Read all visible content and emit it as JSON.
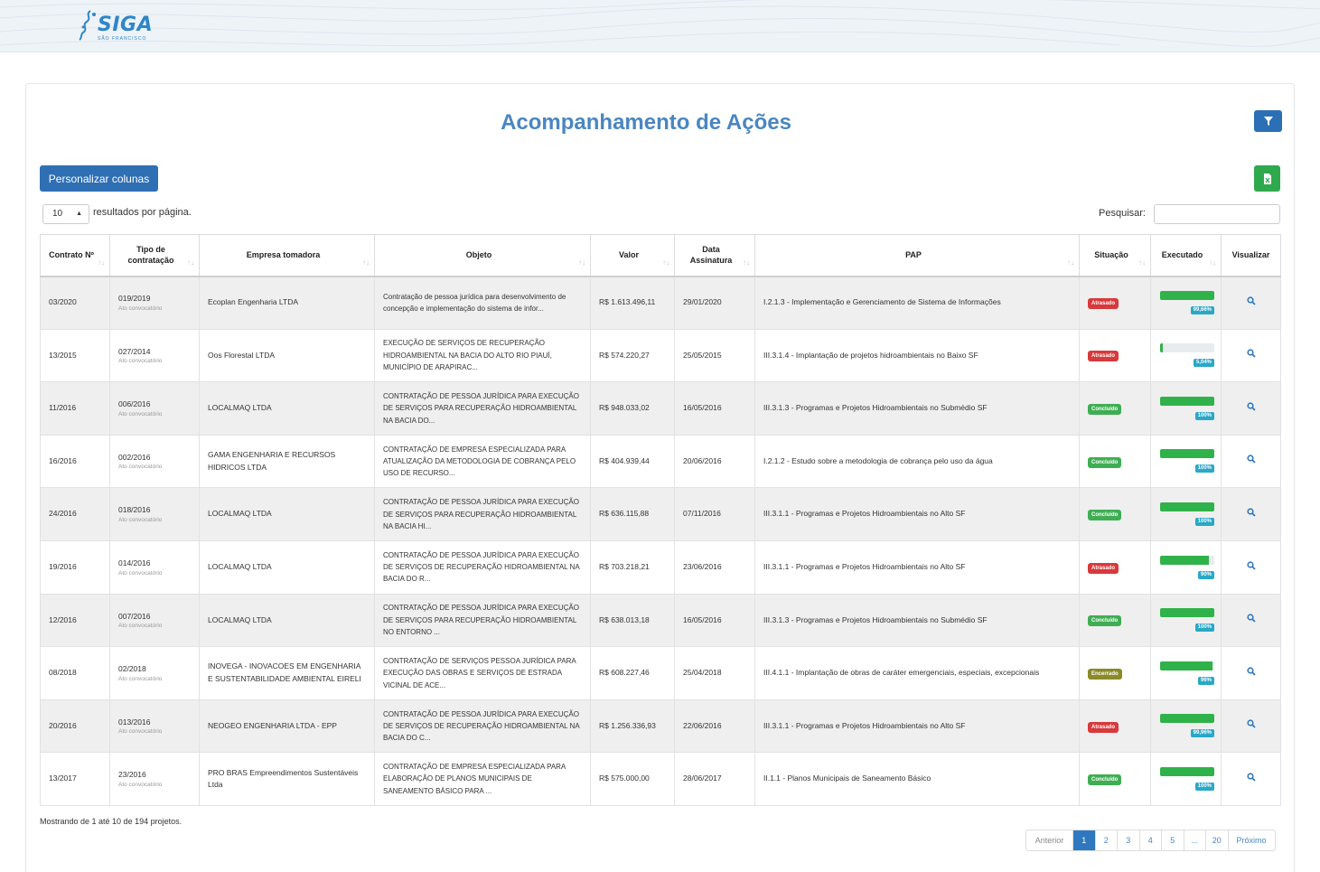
{
  "header": {
    "logo_text": "SIGA",
    "logo_sub": "SÃO FRANCISCO"
  },
  "page": {
    "title": "Acompanhamento de Ações"
  },
  "toolbar": {
    "customize_label": "Personalizar colunas",
    "page_length_value": "10",
    "page_length_suffix": "resultados por página.",
    "search_label": "Pesquisar:",
    "search_value": ""
  },
  "table": {
    "headers": [
      "Contrato Nº",
      "Tipo de contratação",
      "Empresa tomadora",
      "Objeto",
      "Valor",
      "Data Assinatura",
      "PAP",
      "Situação",
      "Executado",
      "Visualizar"
    ],
    "rows": [
      {
        "contrato": "03/2020",
        "tipo": "019/2019",
        "tipo_sub": "Ato convocatório",
        "empresa": "Ecoplan Engenharia LTDA",
        "objeto": "Contratação de pessoa jurídica para desenvolvimento de concepção e implementação do sistema de infor...",
        "valor": "R$ 1.613.496,11",
        "data": "29/01/2020",
        "pap": "I.2.1.3 - Implementação e Gerenciamento de Sistema de Informações",
        "situacao": "Atrasado",
        "situacao_color": "#d9393b",
        "executado": "99,66%",
        "executado_frac": 0.9966
      },
      {
        "contrato": "13/2015",
        "tipo": "027/2014",
        "tipo_sub": "Ato convocatório",
        "empresa": "Oos Florestal LTDA",
        "objeto": "EXECUÇÃO DE SERVIÇOS DE RECUPERAÇÃO HIDROAMBIENTAL NA BACIA DO ALTO RIO PIAUÍ, MUNICÍPIO DE ARAPIRAC...",
        "valor": "R$ 574.220,27",
        "data": "25/05/2015",
        "pap": "III.3.1.4 - Implantação de projetos hidroambientais no Baixo SF",
        "situacao": "Atrasado",
        "situacao_color": "#d9393b",
        "executado": "5,04%",
        "executado_frac": 0.0504
      },
      {
        "contrato": "11/2016",
        "tipo": "006/2016",
        "tipo_sub": "Ato convocatório",
        "empresa": "LOCALMAQ LTDA",
        "objeto": "CONTRATAÇÃO DE PESSOA JURÍDICA PARA EXECUÇÃO DE SERVIÇOS PARA RECUPERAÇÃO HIDROAMBIENTAL NA BACIA DO...",
        "valor": "R$ 948.033,02",
        "data": "16/05/2016",
        "pap": "III.3.1.3 - Programas e Projetos Hidroambientais no Submédio SF",
        "situacao": "Concluído",
        "situacao_color": "#3fae53",
        "executado": "100%",
        "executado_frac": 1.0
      },
      {
        "contrato": "16/2016",
        "tipo": "002/2016",
        "tipo_sub": "Ato convocatório",
        "empresa": "GAMA ENGENHARIA E RECURSOS HIDRICOS LTDA",
        "objeto": "CONTRATAÇÃO DE EMPRESA ESPECIALIZADA PARA ATUALIZAÇÃO DA METODOLOGIA DE COBRANÇA PELO USO DE RECURSO...",
        "valor": "R$ 404.939,44",
        "data": "20/06/2016",
        "pap": "I.2.1.2 - Estudo sobre a metodologia de cobrança pelo uso da água",
        "situacao": "Concluído",
        "situacao_color": "#3fae53",
        "executado": "100%",
        "executado_frac": 1.0
      },
      {
        "contrato": "24/2016",
        "tipo": "018/2016",
        "tipo_sub": "Ato convocatório",
        "empresa": "LOCALMAQ LTDA",
        "objeto": "CONTRATAÇÃO DE PESSOA JURÍDICA PARA EXECUÇÃO DE SERVIÇOS PARA RECUPERAÇÃO HIDROAMBIENTAL NA BACIA HI...",
        "valor": "R$ 636.115,88",
        "data": "07/11/2016",
        "pap": "III.3.1.1 - Programas e Projetos Hidroambientais no Alto SF",
        "situacao": "Concluído",
        "situacao_color": "#3fae53",
        "executado": "100%",
        "executado_frac": 1.0
      },
      {
        "contrato": "19/2016",
        "tipo": "014/2016",
        "tipo_sub": "Ato convocatório",
        "empresa": "LOCALMAQ LTDA",
        "objeto": "CONTRATAÇÃO DE PESSOA JURÍDICA PARA EXECUÇÃO DE SERVIÇOS DE RECUPERAÇÃO HIDROAMBIENTAL NA BACIA DO R...",
        "valor": "R$ 703.218,21",
        "data": "23/06/2016",
        "pap": "III.3.1.1 - Programas e Projetos Hidroambientais no Alto SF",
        "situacao": "Atrasado",
        "situacao_color": "#d9393b",
        "executado": "90%",
        "executado_frac": 0.9
      },
      {
        "contrato": "12/2016",
        "tipo": "007/2016",
        "tipo_sub": "Ato convocatório",
        "empresa": "LOCALMAQ LTDA",
        "objeto": "CONTRATAÇÃO DE PESSOA JURÍDICA PARA EXECUÇÃO DE SERVIÇOS PARA RECUPERAÇÃO HIDROAMBIENTAL NO ENTORNO ...",
        "valor": "R$ 638.013,18",
        "data": "16/05/2016",
        "pap": "III.3.1.3 - Programas e Projetos Hidroambientais no Submédio SF",
        "situacao": "Concluído",
        "situacao_color": "#3fae53",
        "executado": "100%",
        "executado_frac": 1.0
      },
      {
        "contrato": "08/2018",
        "tipo": "02/2018",
        "tipo_sub": "Ato convocatório",
        "empresa": "INOVEGA - INOVACOES EM ENGENHARIA E SUSTENTABILIDADE AMBIENTAL EIRELI",
        "objeto": "CONTRATAÇÃO DE SERVIÇOS PESSOA JURÍDICA PARA EXECUÇÃO DAS OBRAS E SERVIÇOS DE ESTRADA VICINAL DE ACE...",
        "valor": "R$ 608.227,46",
        "data": "25/04/2018",
        "pap": "III.4.1.1 - Implantação de obras de caráter emergenciais, especiais, excepcionais",
        "situacao": "Encerrado",
        "situacao_color": "#8a8a2a",
        "executado": "96%",
        "executado_frac": 0.96
      },
      {
        "contrato": "20/2016",
        "tipo": "013/2016",
        "tipo_sub": "Ato convocatório",
        "empresa": "NEOGEO ENGENHARIA LTDA - EPP",
        "objeto": "CONTRATAÇÃO DE PESSOA JURÍDICA PARA EXECUÇÃO DE SERVIÇOS DE RECUPERAÇÃO HIDROAMBIENTAL NA BACIA DO C...",
        "valor": "R$ 1.256.336,93",
        "data": "22/06/2016",
        "pap": "III.3.1.1 - Programas e Projetos Hidroambientais no Alto SF",
        "situacao": "Atrasado",
        "situacao_color": "#d9393b",
        "executado": "99,96%",
        "executado_frac": 0.9996
      },
      {
        "contrato": "13/2017",
        "tipo": "23/2016",
        "tipo_sub": "Ato convocatório",
        "empresa": "PRO BRAS Empreendimentos Sustentáveis Ltda",
        "objeto": "CONTRATAÇÃO DE EMPRESA ESPECIALIZADA PARA ELABORAÇÃO DE PLANOS MUNICIPAIS DE SANEAMENTO BÁSICO PARA ...",
        "valor": "R$ 575.000,00",
        "data": "28/06/2017",
        "pap": "II.1.1 - Planos Municipais de Saneamento Básico",
        "situacao": "Concluído",
        "situacao_color": "#3fae53",
        "executado": "100%",
        "executado_frac": 1.0
      }
    ]
  },
  "footer": {
    "info": "Mostrando de 1 até 10 de 194 projetos.",
    "pagination": [
      "Anterior",
      "1",
      "2",
      "3",
      "4",
      "5",
      "...",
      "20",
      "Próximo"
    ],
    "active_page": "1"
  },
  "colors": {
    "accent": "#2f6fb4",
    "title": "#4a86c0",
    "excel": "#2fa94e",
    "progress": "#30b24a",
    "progress_label": "#29a8c8"
  }
}
